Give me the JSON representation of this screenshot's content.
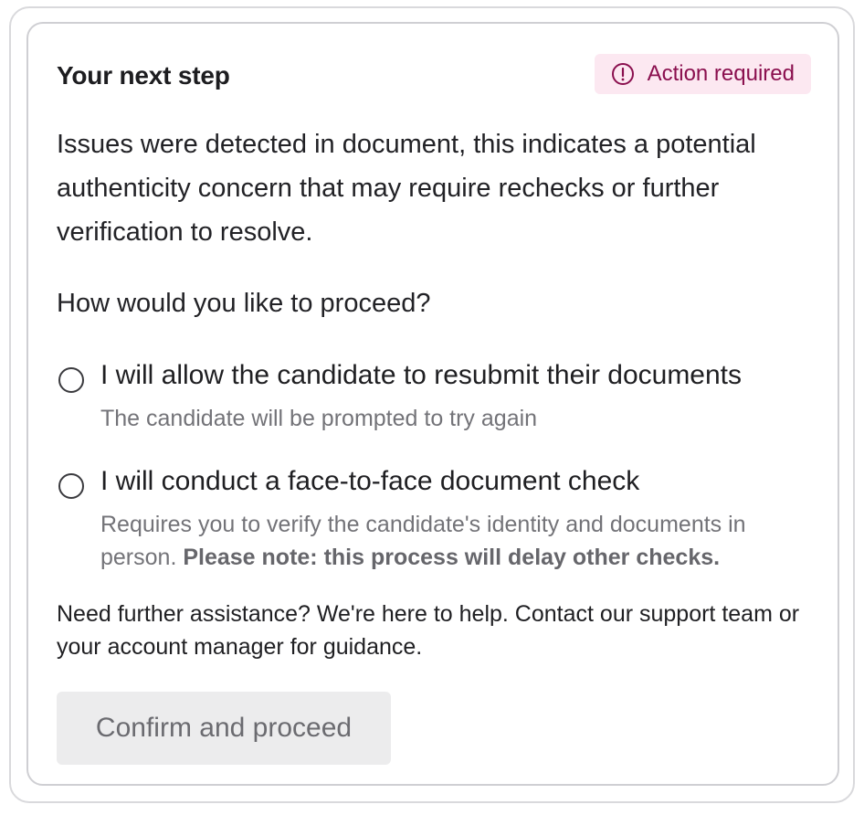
{
  "card": {
    "title": "Your next step",
    "badge": {
      "label": "Action required",
      "icon": "alert-circle-icon",
      "background": "#fce8f1",
      "color": "#8a0f4e"
    },
    "intro": "Issues were detected in document, this indicates a potential authenticity concern that may require rechecks or further verification to resolve.",
    "question": "How would you like to proceed?",
    "options": [
      {
        "label": "I will allow the candidate to resubmit their documents",
        "description": "The candidate will be prompted to try again",
        "selected": false
      },
      {
        "label": "I will conduct a face-to-face document check",
        "description": "Requires you to verify the candidate's identity and documents in person.",
        "note": "Please note: this process will delay other checks.",
        "selected": false
      }
    ],
    "help_text": "Need further assistance? We're here to help. Contact our support team or your account manager for guidance.",
    "confirm_button": {
      "label": "Confirm and proceed",
      "disabled": true
    }
  }
}
